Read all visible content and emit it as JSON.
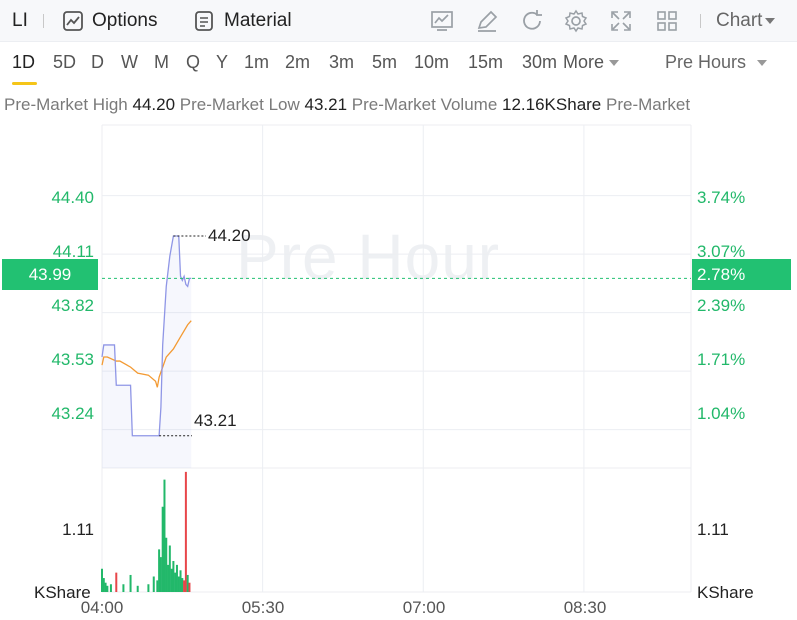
{
  "toolbar": {
    "symbol": "LI",
    "options_label": "Options",
    "material_label": "Material",
    "chart_label": "Chart"
  },
  "periods": [
    "1D",
    "5D",
    "D",
    "W",
    "M",
    "Q",
    "Y",
    "1m",
    "2m",
    "3m",
    "5m",
    "10m",
    "15m",
    "30m"
  ],
  "more_label": "More",
  "session_label": "Pre Hours",
  "premarket": {
    "high_label": "Pre-Market High",
    "high_value": "44.20",
    "low_label": "Pre-Market Low",
    "low_value": "43.21",
    "volume_label": "Pre-Market Volume",
    "volume_value": "12.16KShare",
    "tail_label": "Pre-Market"
  },
  "watermark": "Pre Hour",
  "current_price": "43.99",
  "current_pct": "2.78%",
  "colors": {
    "up": "#22b86a",
    "down": "#e8464a",
    "price_line": "#8f96e6",
    "avg_line": "#f39a33",
    "badge": "#22c172",
    "active_tab": "#f5c518"
  },
  "chart_data": {
    "type": "line",
    "x_ticks": [
      "04:00",
      "05:30",
      "07:00",
      "08:30"
    ],
    "xlim": [
      "04:00",
      "09:30"
    ],
    "ylim": [
      43.05,
      44.75
    ],
    "y_ticks_left": [
      "44.40",
      "44.11",
      "43.82",
      "43.53",
      "43.24"
    ],
    "y_ticks_right": [
      "3.74%",
      "3.07%",
      "2.39%",
      "1.71%",
      "1.04%"
    ],
    "annotations": {
      "high": "44.20",
      "low": "43.21"
    },
    "series": [
      {
        "name": "",
        "x": [
          "04:00",
          "04:01",
          "04:07",
          "04:08",
          "04:16",
          "04:17",
          "04:32",
          "04:33",
          "04:34",
          "04:36",
          "04:38",
          "04:40",
          "04:43",
          "04:44",
          "04:45",
          "04:46",
          "04:47",
          "04:48",
          "04:49",
          "04:50"
        ],
        "y": [
          43.6,
          43.66,
          43.66,
          43.46,
          43.46,
          43.21,
          43.21,
          43.35,
          43.66,
          43.95,
          44.1,
          44.2,
          44.2,
          44.0,
          43.98,
          44.0,
          43.96,
          43.95,
          43.99,
          43.99
        ]
      },
      {
        "name": "",
        "x": [
          "04:00",
          "04:01",
          "04:03",
          "04:08",
          "04:10",
          "04:16",
          "04:20",
          "04:26",
          "04:30",
          "04:31",
          "04:32",
          "04:34",
          "04:36",
          "04:40",
          "04:44",
          "04:48",
          "04:50"
        ],
        "y": [
          43.56,
          43.6,
          43.6,
          43.58,
          43.58,
          43.55,
          43.52,
          43.51,
          43.48,
          43.45,
          43.5,
          43.55,
          43.6,
          43.64,
          43.7,
          43.76,
          43.78
        ]
      }
    ],
    "volume": {
      "ylabel": "KShare",
      "y_tick": "1.11",
      "ylim": [
        0,
        1.6
      ],
      "bars": [
        {
          "t": "04:00",
          "v": 0.3,
          "dir": "up"
        },
        {
          "t": "04:01",
          "v": 0.18,
          "dir": "up"
        },
        {
          "t": "04:02",
          "v": 0.12,
          "dir": "up"
        },
        {
          "t": "04:03",
          "v": 0.08,
          "dir": "up"
        },
        {
          "t": "04:05",
          "v": 0.1,
          "dir": "up"
        },
        {
          "t": "04:08",
          "v": 0.25,
          "dir": "down"
        },
        {
          "t": "04:12",
          "v": 0.1,
          "dir": "up"
        },
        {
          "t": "04:16",
          "v": 0.22,
          "dir": "up"
        },
        {
          "t": "04:20",
          "v": 0.08,
          "dir": "up"
        },
        {
          "t": "04:26",
          "v": 0.1,
          "dir": "up"
        },
        {
          "t": "04:29",
          "v": 0.2,
          "dir": "up"
        },
        {
          "t": "04:31",
          "v": 0.15,
          "dir": "up"
        },
        {
          "t": "04:32",
          "v": 0.55,
          "dir": "up"
        },
        {
          "t": "04:33",
          "v": 0.45,
          "dir": "up"
        },
        {
          "t": "04:34",
          "v": 1.1,
          "dir": "up"
        },
        {
          "t": "04:35",
          "v": 1.45,
          "dir": "up"
        },
        {
          "t": "04:36",
          "v": 0.7,
          "dir": "up"
        },
        {
          "t": "04:37",
          "v": 0.35,
          "dir": "up"
        },
        {
          "t": "04:38",
          "v": 0.6,
          "dir": "up"
        },
        {
          "t": "04:39",
          "v": 0.3,
          "dir": "up"
        },
        {
          "t": "04:40",
          "v": 0.4,
          "dir": "up"
        },
        {
          "t": "04:41",
          "v": 0.25,
          "dir": "up"
        },
        {
          "t": "04:42",
          "v": 0.35,
          "dir": "up"
        },
        {
          "t": "04:43",
          "v": 0.2,
          "dir": "up"
        },
        {
          "t": "04:44",
          "v": 0.28,
          "dir": "up"
        },
        {
          "t": "04:45",
          "v": 0.18,
          "dir": "up"
        },
        {
          "t": "04:46",
          "v": 0.15,
          "dir": "down"
        },
        {
          "t": "04:47",
          "v": 1.55,
          "dir": "down"
        },
        {
          "t": "04:48",
          "v": 0.22,
          "dir": "up"
        },
        {
          "t": "04:49",
          "v": 0.12,
          "dir": "down"
        }
      ]
    }
  }
}
